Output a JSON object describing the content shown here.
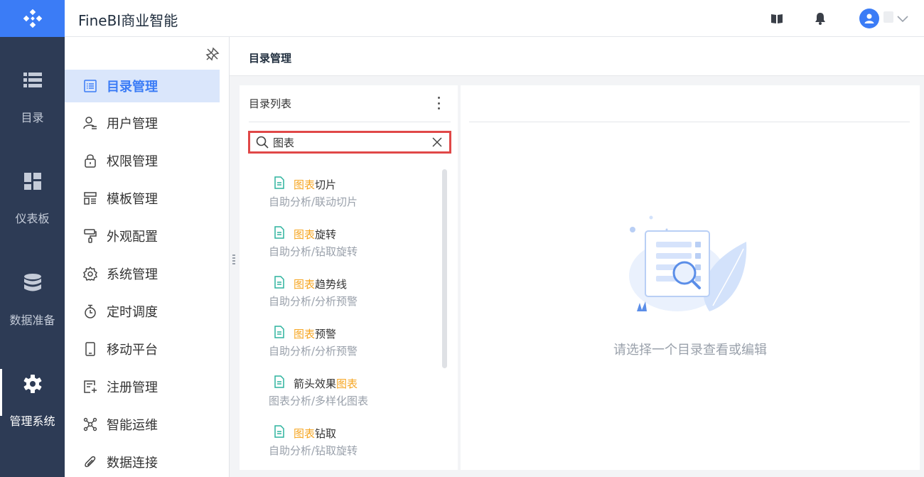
{
  "header": {
    "app_title": "FineBI商业智能"
  },
  "rail": {
    "items": [
      {
        "label": "目录",
        "icon": "list-icon"
      },
      {
        "label": "仪表板",
        "icon": "dashboard-icon"
      },
      {
        "label": "数据准备",
        "icon": "database-icon"
      },
      {
        "label": "管理系统",
        "icon": "gear-icon",
        "active": true
      }
    ]
  },
  "menu": {
    "items": [
      {
        "label": "目录管理",
        "icon": "catalog-icon",
        "active": true
      },
      {
        "label": "用户管理",
        "icon": "user-icon"
      },
      {
        "label": "权限管理",
        "icon": "lock-icon"
      },
      {
        "label": "模板管理",
        "icon": "template-icon"
      },
      {
        "label": "外观配置",
        "icon": "brush-icon"
      },
      {
        "label": "系统管理",
        "icon": "settings-icon"
      },
      {
        "label": "定时调度",
        "icon": "stopwatch-icon"
      },
      {
        "label": "移动平台",
        "icon": "mobile-icon"
      },
      {
        "label": "注册管理",
        "icon": "register-icon"
      },
      {
        "label": "智能运维",
        "icon": "ops-icon"
      },
      {
        "label": "数据连接",
        "icon": "paperclip-icon"
      }
    ]
  },
  "page": {
    "title": "目录管理"
  },
  "directory": {
    "title": "目录列表",
    "search_value": "图表",
    "results": [
      {
        "pre": "",
        "hl": "图表",
        "post": "切片",
        "path": "自助分析/联动切片"
      },
      {
        "pre": "",
        "hl": "图表",
        "post": "旋转",
        "path": "自助分析/钻取旋转"
      },
      {
        "pre": "",
        "hl": "图表",
        "post": "趋势线",
        "path": "自助分析/分析预警"
      },
      {
        "pre": "",
        "hl": "图表",
        "post": "预警",
        "path": "自助分析/分析预警"
      },
      {
        "pre": "箭头效果",
        "hl": "图表",
        "post": "",
        "path": "图表分析/多样化图表"
      },
      {
        "pre": "",
        "hl": "图表",
        "post": "钻取",
        "path": "自助分析/钻取旋转"
      }
    ]
  },
  "detail": {
    "empty_text": "请选择一个目录查看或编辑"
  },
  "colors": {
    "accent": "#3b7cf6",
    "rail_bg": "#2d3b55",
    "highlight": "#f6a623",
    "doc_icon": "#2db39e",
    "search_border": "#e04848"
  }
}
